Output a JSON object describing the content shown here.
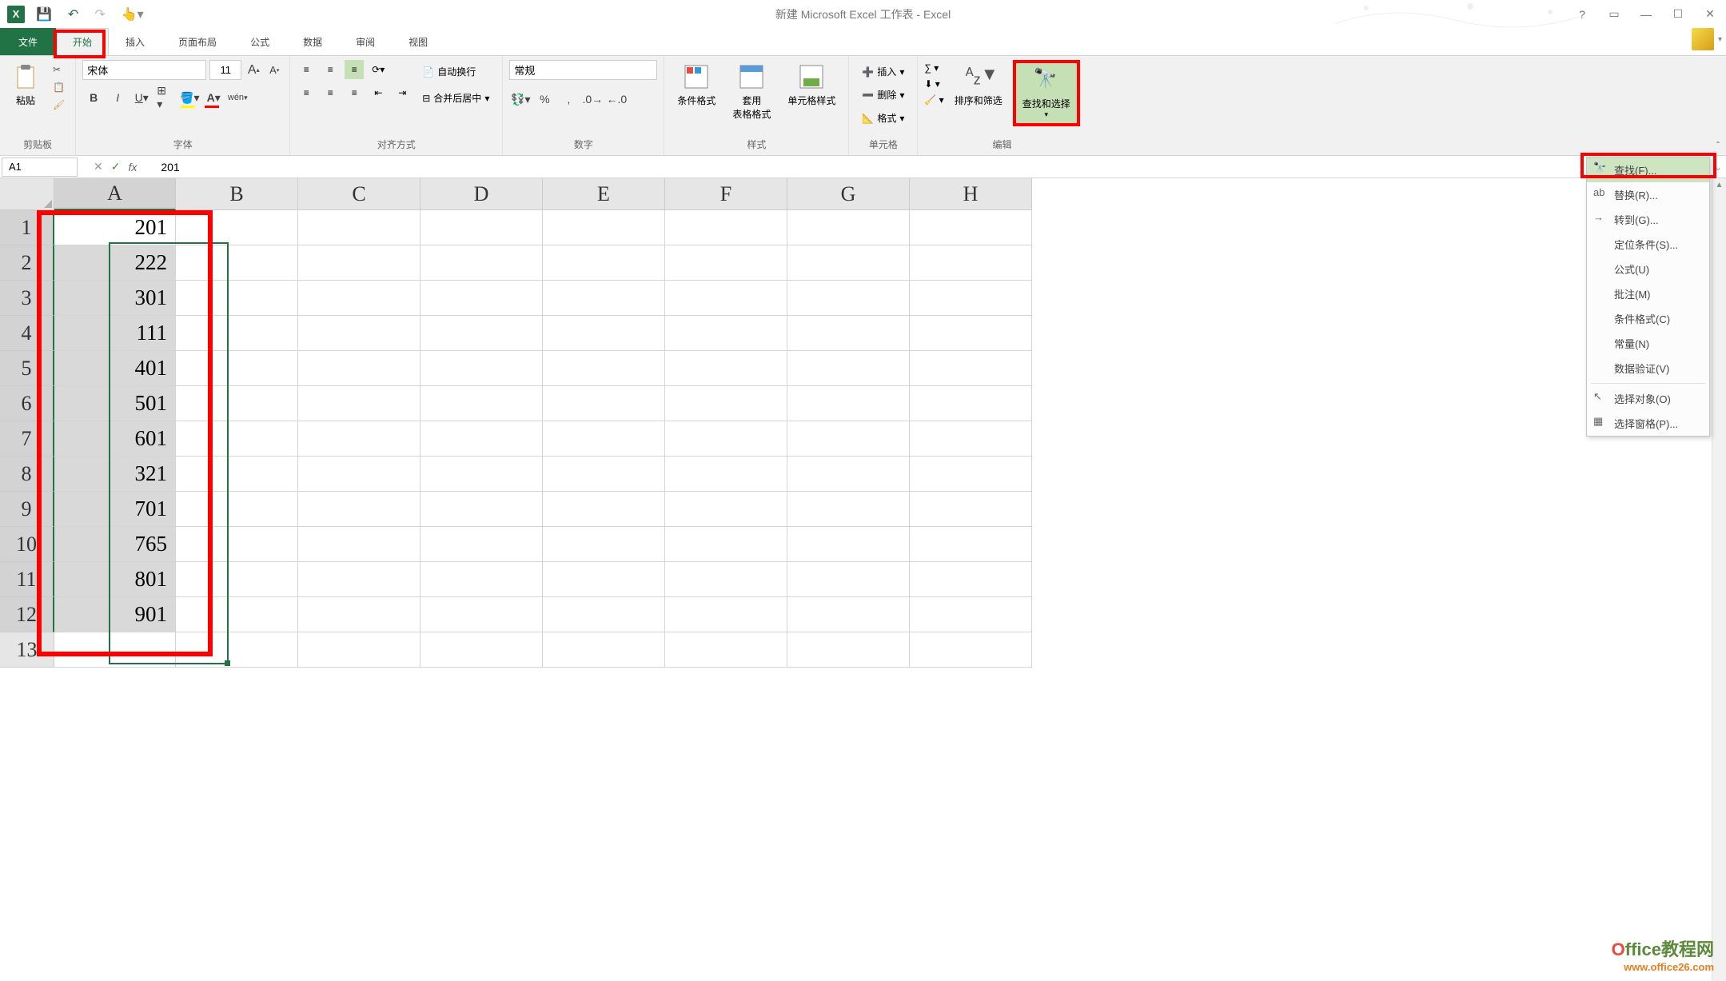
{
  "title": "新建 Microsoft Excel 工作表 - Excel",
  "tabs": {
    "file": "文件",
    "home": "开始",
    "insert": "插入",
    "layout": "页面布局",
    "formulas": "公式",
    "data": "数据",
    "review": "审阅",
    "view": "视图"
  },
  "ribbon": {
    "clipboard": {
      "paste": "粘贴",
      "label": "剪贴板"
    },
    "font": {
      "name": "宋体",
      "size": "11",
      "label": "字体"
    },
    "alignment": {
      "wrap": "自动换行",
      "merge": "合并后居中",
      "label": "对齐方式"
    },
    "number": {
      "format": "常规",
      "label": "数字"
    },
    "styles": {
      "conditional": "条件格式",
      "table": "套用\n表格格式",
      "cell": "单元格样式",
      "label": "样式"
    },
    "cells": {
      "insert": "插入",
      "delete": "删除",
      "format": "格式",
      "label": "单元格"
    },
    "editing": {
      "sort": "排序和筛选",
      "find": "查找和选择",
      "label": "编辑"
    }
  },
  "formula_bar": {
    "name_box": "A1",
    "formula": "201"
  },
  "columns": [
    "A",
    "B",
    "C",
    "D",
    "E",
    "F",
    "G",
    "H"
  ],
  "col_widths": {
    "A": 152,
    "B": 153,
    "C": 153,
    "D": 153,
    "E": 153,
    "F": 153,
    "G": 153,
    "H": 153
  },
  "rows": [
    1,
    2,
    3,
    4,
    5,
    6,
    7,
    8,
    9,
    10,
    11,
    12,
    13
  ],
  "data_column_A": [
    "201",
    "222",
    "301",
    "111",
    "401",
    "501",
    "601",
    "321",
    "701",
    "765",
    "801",
    "901"
  ],
  "dropdown": {
    "find": "查找(F)...",
    "replace": "替换(R)...",
    "goto": "转到(G)...",
    "special": "定位条件(S)...",
    "formulas": "公式(U)",
    "comments": "批注(M)",
    "conditional": "条件格式(C)",
    "constants": "常量(N)",
    "validation": "数据验证(V)",
    "objects": "选择对象(O)",
    "pane": "选择窗格(P)..."
  },
  "watermark": {
    "line1_o": "O",
    "line1_rest": "ffice教程网",
    "line2": "www.office26.com"
  }
}
